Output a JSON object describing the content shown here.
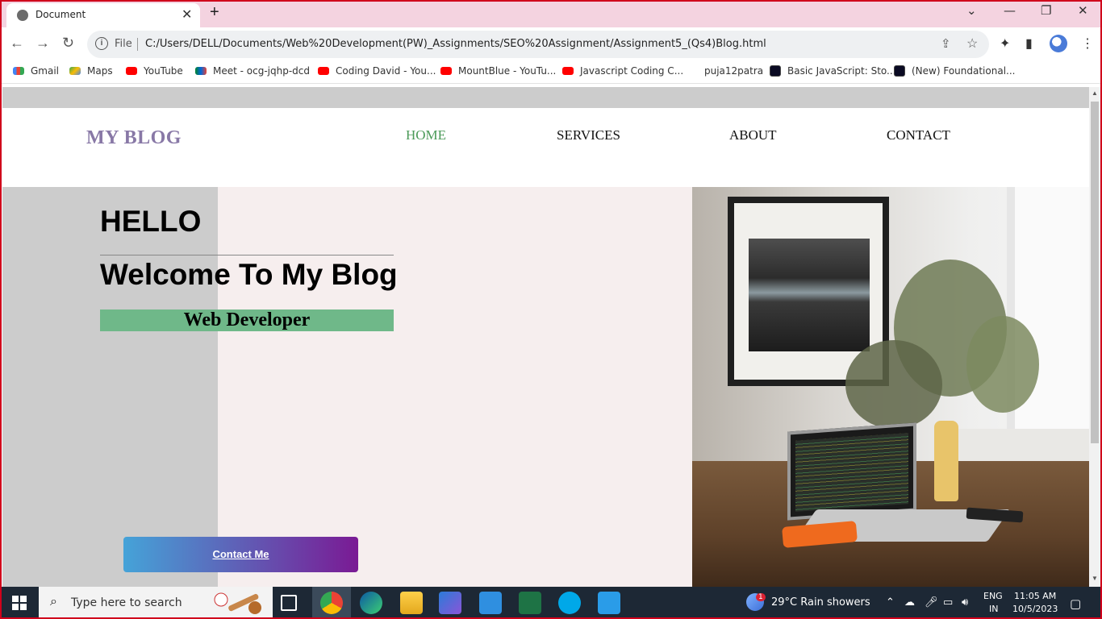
{
  "browser": {
    "tab_title": "Document",
    "file_label": "File",
    "url": "C:/Users/DELL/Documents/Web%20Development(PW)_Assignments/SEO%20Assignment/Assignment5_(Qs4)Blog.html"
  },
  "bookmarks": [
    {
      "label": "Gmail",
      "icon": "gmail-icon"
    },
    {
      "label": "Maps",
      "icon": "maps-icon"
    },
    {
      "label": "YouTube",
      "icon": "youtube-icon"
    },
    {
      "label": "Meet - ocg-jqhp-dcd",
      "icon": "meet-icon"
    },
    {
      "label": "Coding David - You...",
      "icon": "youtube-icon"
    },
    {
      "label": "MountBlue - YouTu...",
      "icon": "youtube-icon"
    },
    {
      "label": "Javascript Coding C...",
      "icon": "youtube-icon"
    },
    {
      "label": "puja12patra",
      "icon": "none"
    },
    {
      "label": "Basic JavaScript: Sto...",
      "icon": "freecodecamp-icon"
    },
    {
      "label": "(New) Foundational...",
      "icon": "freecodecamp-icon"
    }
  ],
  "page": {
    "logo": "MY BLOG",
    "nav": [
      {
        "label": "HOME",
        "active": true
      },
      {
        "label": "SERVICES",
        "active": false
      },
      {
        "label": "ABOUT",
        "active": false
      },
      {
        "label": "CONTACT",
        "active": false
      }
    ],
    "hero": {
      "greeting": "HELLO",
      "headline": "Welcome To My Blog",
      "role": "Web Developer",
      "cta": "Contact Me"
    },
    "colors": {
      "logo": "#8878a6",
      "nav_active": "#4b9a58",
      "role_bg": "#6fb889",
      "cta_gradient_start": "#45a3d8",
      "cta_gradient_end": "#7a1a94"
    }
  },
  "taskbar": {
    "search_placeholder": "Type here to search",
    "weather": "29°C  Rain showers",
    "lang_top": "ENG",
    "lang_bottom": "IN",
    "time": "11:05 AM",
    "date": "10/5/2023",
    "weather_badge": "1"
  }
}
